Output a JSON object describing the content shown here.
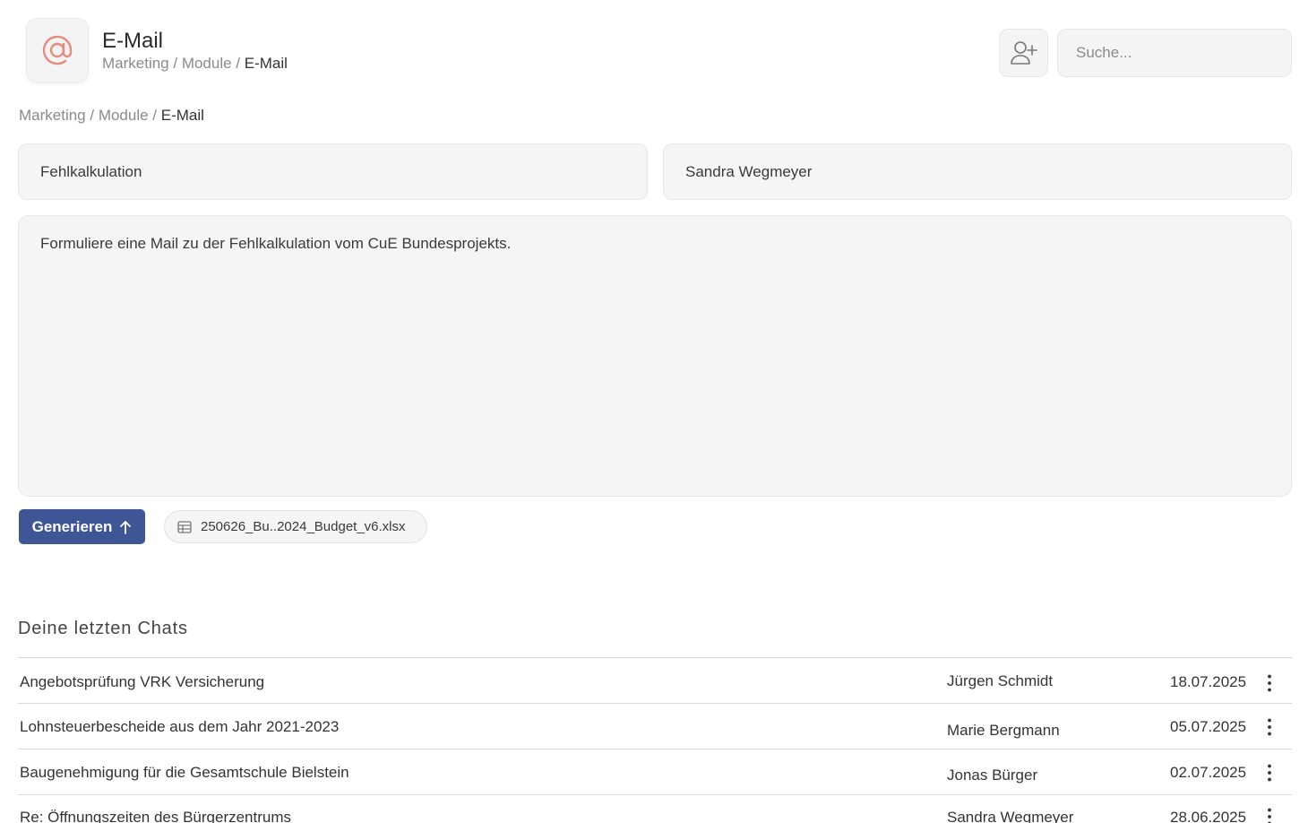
{
  "app": {
    "title": "E-Mail",
    "logo_icon": "at-sign-icon",
    "accent_color": "#e8897a"
  },
  "header_breadcrumb": {
    "part1": "Marketing",
    "sep1": " / ",
    "part2": "Module",
    "sep2": " / ",
    "current": "E-Mail"
  },
  "page_breadcrumb": {
    "part1": "Marketing",
    "sep1": " / ",
    "part2": "Module",
    "sep2": " / ",
    "current": "E-Mail"
  },
  "search": {
    "placeholder": "Suche..."
  },
  "form": {
    "subject": "Fehlkalkulation",
    "recipient": "Sandra Wegmeyer",
    "prompt": "Formuliere eine Mail zu der Fehlkalkulation vom CuE Bundesprojekts."
  },
  "actions": {
    "generate_label": "Generieren",
    "button_color": "#3e5596"
  },
  "attachment": {
    "filename": "250626_Bu..2024_Budget_v6.xlsx",
    "icon": "spreadsheet-icon"
  },
  "recent_chats": {
    "title": "Deine letzten Chats",
    "items": [
      {
        "title": "Angebotsprüfung VRK Versicherung",
        "person": "Jürgen Schmidt",
        "date": "18.07.2025"
      },
      {
        "title": "Lohnsteuerbescheide aus dem Jahr 2021-2023",
        "person": "Marie Bergmann",
        "date": "05.07.2025"
      },
      {
        "title": "Baugenehmigung für die Gesamtschule Bielstein",
        "person": "Jonas Bürger",
        "date": "02.07.2025"
      },
      {
        "title": "Re: Öffnungszeiten des Bürgerzentrums",
        "person": "Sandra Wegmeyer",
        "date": "28.06.2025"
      }
    ]
  }
}
